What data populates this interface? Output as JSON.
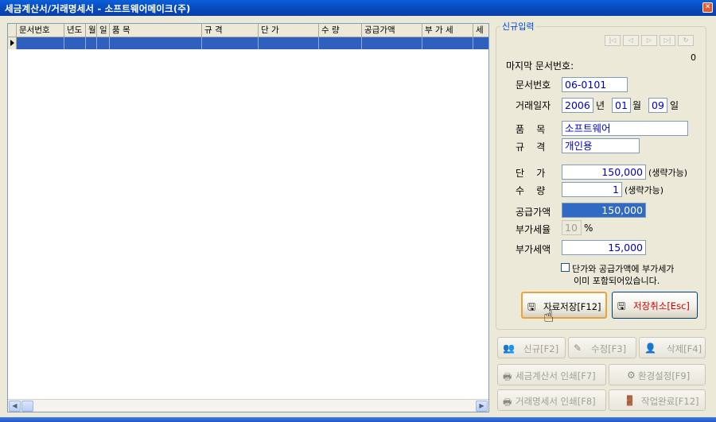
{
  "window": {
    "title": "세금계산서/거래명세서 - 소프트웨어메이크(주)",
    "close_glyph": "✕"
  },
  "grid": {
    "columns": [
      "문서번호",
      "년도",
      "월",
      "일",
      "품 목",
      "규 격",
      "단 가",
      "수 량",
      "공급가액",
      "부 가 세",
      "세"
    ],
    "scroll_left_glyph": "◀",
    "scroll_right_glyph": "▶"
  },
  "panel": {
    "legend": "신규입력",
    "nav_glyphs": [
      "|◁",
      "◁",
      "▷",
      "▷|",
      "↻"
    ],
    "record_count": "0",
    "last_doc_label": "마지막 문서번호:",
    "doc_no_label": "문서번호",
    "doc_no_value": "06-0101",
    "date_label": "거래일자",
    "year_value": "2006",
    "year_unit": "년",
    "month_value": "01",
    "month_unit": "월",
    "day_value": "09",
    "day_unit": "일",
    "item_label": "품    목",
    "item_value": "소프트웨어",
    "spec_label": "규    격",
    "spec_value": "개인용",
    "price_label": "단    가",
    "price_value": "150,000",
    "price_note": "(생략가능)",
    "qty_label": "수    량",
    "qty_value": "1",
    "qty_note": "(생략가능)",
    "supply_label": "공급가액",
    "supply_value": "150,000",
    "vat_rate_label": "부가세율",
    "vat_rate_value": "10",
    "vat_rate_unit": "%",
    "vat_label": "부가세액",
    "vat_value": "15,000",
    "vat_included_line1": "단가와 공급가액에 부가세가",
    "vat_included_line2": "이미 포함되어있습니다.",
    "save_label": "자료저장[F12]",
    "cancel_label": "저장취소[Esc]"
  },
  "actions": {
    "new_label": "신규[F2]",
    "edit_label": "수정[F3]",
    "delete_label": "삭제[F4]",
    "print_invoice_label": "세금계산서 인쇄[F7]",
    "settings_label": "환경설정[F9]",
    "print_statement_label": "거래명세서 인쇄[F8]",
    "finish_label": "작업완료[F12]"
  },
  "colors": {
    "accent": "#0046d5",
    "selection": "#316ac5",
    "value_text": "#0000c8",
    "cancel_text": "#d20000"
  }
}
